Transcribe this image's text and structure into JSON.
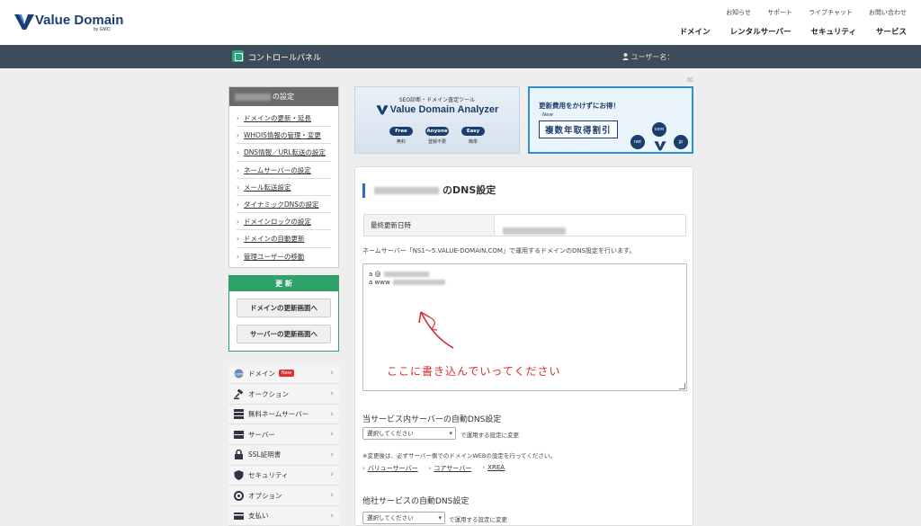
{
  "header": {
    "logo_text": "Value Domain",
    "logo_sub": "by GMO",
    "util_links": [
      "お知らせ",
      "サポート",
      "ライブチャット",
      "お問い合わせ"
    ],
    "main_nav": [
      "ドメイン",
      "レンタルサーバー",
      "セキュリティ",
      "サービス"
    ]
  },
  "cpbar": {
    "title": "コントロールパネル",
    "user_label": "ユーザー名："
  },
  "sidebar": {
    "settings_suffix": "の設定",
    "links": [
      "ドメインの更新・延長",
      "WHOIS情報の管理・変更",
      "DNS情報／URL転送の設定",
      "ネームサーバーの設定",
      "メール転送設定",
      "ダイナミックDNSの設定",
      "ドメインロックの設定",
      "ドメインの自動更新",
      "管理ユーザーの移動"
    ],
    "update_title": "更 新",
    "update_buttons": [
      "ドメインの更新画面へ",
      "サーバーの更新画面へ"
    ],
    "nav": [
      {
        "label": "ドメイン",
        "icon": "domain-icon",
        "badge": "New"
      },
      {
        "label": "オークション",
        "icon": "gavel-icon"
      },
      {
        "label": "無料ネームサーバー",
        "icon": "server-stack-icon"
      },
      {
        "label": "サーバー",
        "icon": "server-icon"
      },
      {
        "label": "SSL証明書",
        "icon": "lock-icon"
      },
      {
        "label": "セキュリティ",
        "icon": "shield-icon"
      },
      {
        "label": "オプション",
        "icon": "option-icon"
      },
      {
        "label": "支払い",
        "icon": "card-icon"
      }
    ]
  },
  "banner1": {
    "top": "SEO診断・ドメイン査定ツール",
    "title": "Value Domain Analyzer",
    "pills": [
      {
        "label": "Free",
        "sub": "無料"
      },
      {
        "label": "Anyone",
        "sub": "登録不要"
      },
      {
        "label": "Easy",
        "sub": "簡単"
      }
    ]
  },
  "banner2": {
    "line1": "更新費用をかけずにお得！",
    "new": "New",
    "badge": "複数年取得割引",
    "circles": [
      "com",
      "net",
      "jp"
    ],
    "close": "☒"
  },
  "main": {
    "title_suffix": "のDNS設定",
    "last_updated_label": "最終更新日時",
    "description": "ネームサーバー「NS1～5.VALUE-DOMAIN.COM」で運用するドメインのDNS設定を行います。",
    "records": [
      "a @",
      "a www"
    ],
    "annotation": "ここに書き込んでいってください",
    "auto_dns_title": "当サービス内サーバーの自動DNS設定",
    "select_placeholder": "選択してください",
    "apply_label": "で運用する設定に変更",
    "note": "※変更後は、必ずサーバー側でのドメインWEBの設定を行ってください。",
    "links": [
      "バリューサーバー",
      "コアサーバー",
      "XREA"
    ],
    "other_title": "他社サービスの自動DNS設定",
    "other_select": "選択してください",
    "other_apply": "で運用する設定に変更"
  },
  "colors": {
    "accent_green": "#2fa26a",
    "navy": "#1b3e6e",
    "bar": "#3d4b5a",
    "handwriting_red": "#d43030"
  }
}
